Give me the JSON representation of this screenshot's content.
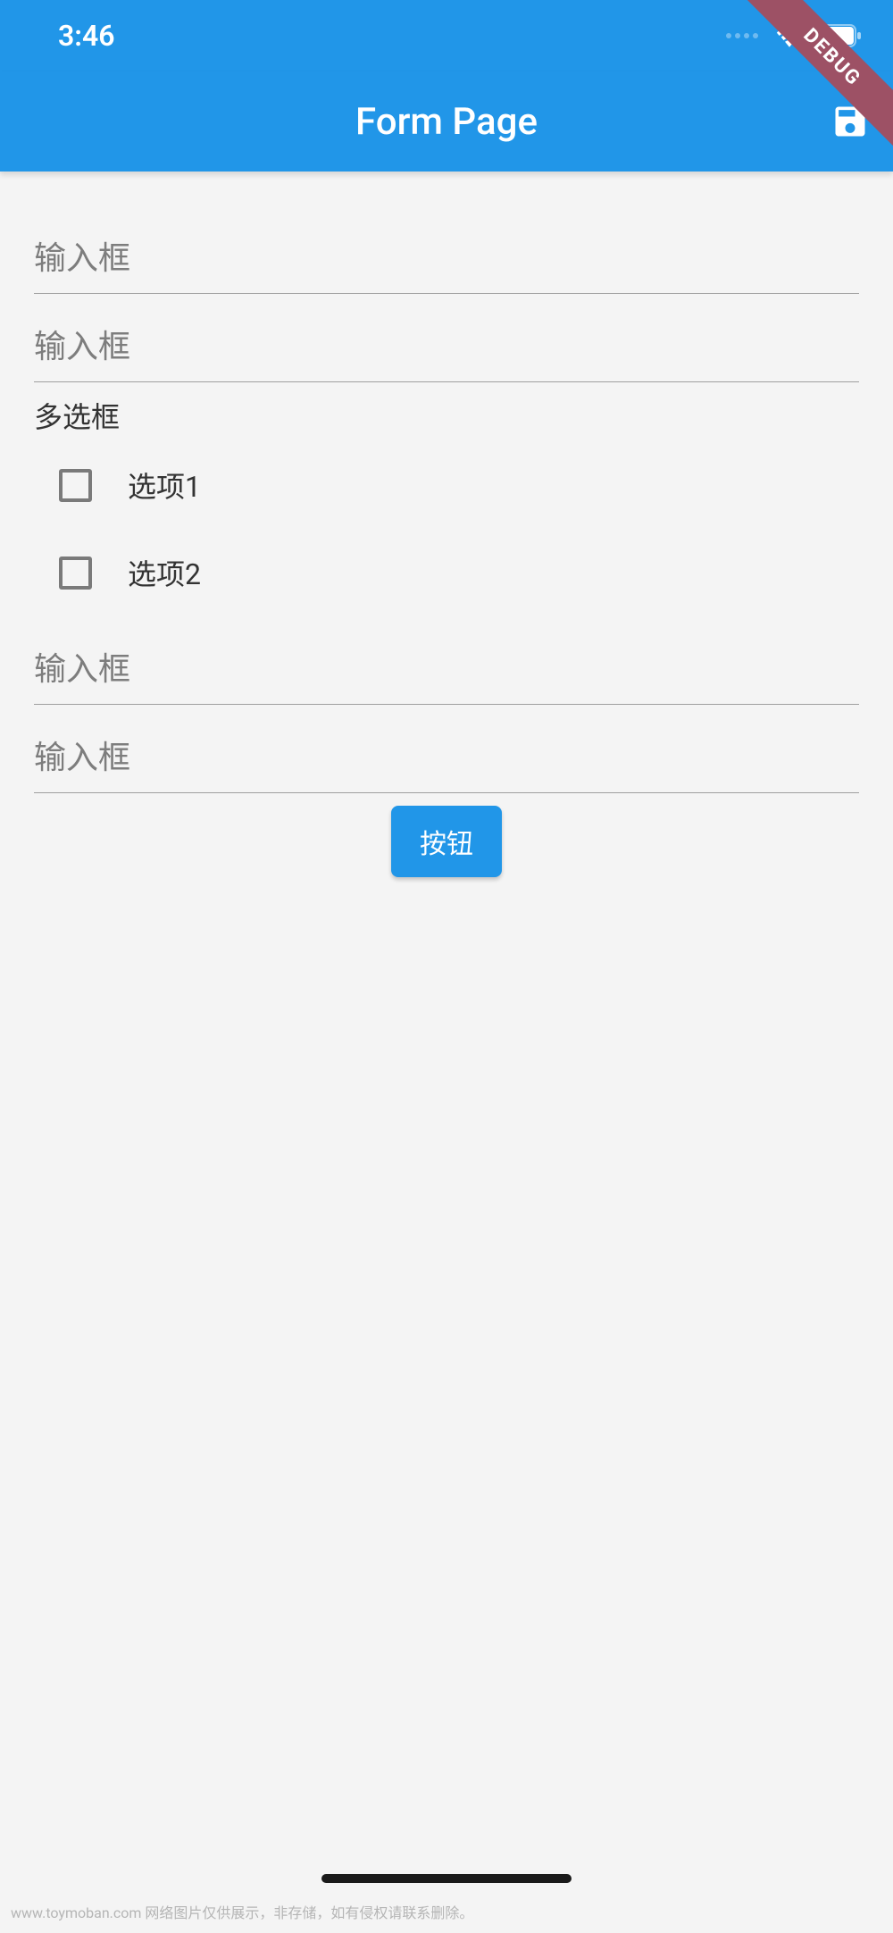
{
  "statusBar": {
    "time": "3:46"
  },
  "appBar": {
    "title": "Form Page"
  },
  "debug": {
    "label": "DEBUG"
  },
  "form": {
    "input1": {
      "placeholder": "输入框",
      "value": ""
    },
    "input2": {
      "placeholder": "输入框",
      "value": ""
    },
    "checkboxGroup": {
      "label": "多选框",
      "options": [
        {
          "label": "选项1",
          "checked": false
        },
        {
          "label": "选项2",
          "checked": false
        }
      ]
    },
    "input3": {
      "placeholder": "输入框",
      "value": ""
    },
    "input4": {
      "placeholder": "输入框",
      "value": ""
    },
    "submitLabel": "按钮"
  },
  "footer": {
    "text": "www.toymoban.com 网络图片仅供展示，非存储，如有侵权请联系删除。"
  }
}
